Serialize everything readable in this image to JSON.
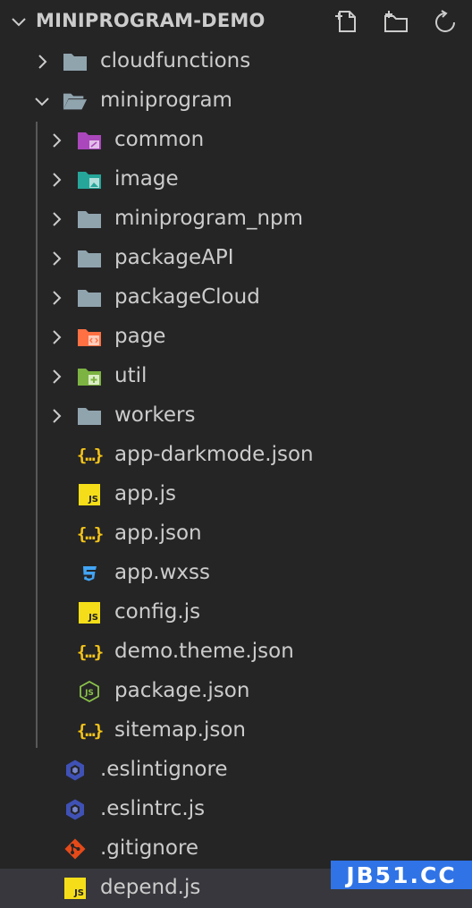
{
  "header": {
    "title": "MINIPROGRAM-DEMO",
    "actions": [
      "new-file-icon",
      "new-folder-icon",
      "refresh-icon"
    ]
  },
  "tree": [
    {
      "label": "cloudfunctions",
      "type": "folder",
      "expanded": false,
      "depth": 0,
      "icon": "folder-icon"
    },
    {
      "label": "miniprogram",
      "type": "folder",
      "expanded": true,
      "depth": 0,
      "icon": "folder-open-icon"
    },
    {
      "label": "common",
      "type": "folder",
      "expanded": false,
      "depth": 1,
      "icon": "folder-common-icon"
    },
    {
      "label": "image",
      "type": "folder",
      "expanded": false,
      "depth": 1,
      "icon": "folder-image-icon"
    },
    {
      "label": "miniprogram_npm",
      "type": "folder",
      "expanded": false,
      "depth": 1,
      "icon": "folder-icon"
    },
    {
      "label": "packageAPI",
      "type": "folder",
      "expanded": false,
      "depth": 1,
      "icon": "folder-icon"
    },
    {
      "label": "packageCloud",
      "type": "folder",
      "expanded": false,
      "depth": 1,
      "icon": "folder-icon"
    },
    {
      "label": "page",
      "type": "folder",
      "expanded": false,
      "depth": 1,
      "icon": "folder-page-icon"
    },
    {
      "label": "util",
      "type": "folder",
      "expanded": false,
      "depth": 1,
      "icon": "folder-util-icon"
    },
    {
      "label": "workers",
      "type": "folder",
      "expanded": false,
      "depth": 1,
      "icon": "folder-icon"
    },
    {
      "label": "app-darkmode.json",
      "type": "file",
      "depth": 1,
      "icon": "json-icon"
    },
    {
      "label": "app.js",
      "type": "file",
      "depth": 1,
      "icon": "js-icon"
    },
    {
      "label": "app.json",
      "type": "file",
      "depth": 1,
      "icon": "json-icon"
    },
    {
      "label": "app.wxss",
      "type": "file",
      "depth": 1,
      "icon": "css-icon"
    },
    {
      "label": "config.js",
      "type": "file",
      "depth": 1,
      "icon": "js-icon"
    },
    {
      "label": "demo.theme.json",
      "type": "file",
      "depth": 1,
      "icon": "json-icon"
    },
    {
      "label": "package.json",
      "type": "file",
      "depth": 1,
      "icon": "nodejs-icon"
    },
    {
      "label": "sitemap.json",
      "type": "file",
      "depth": 1,
      "icon": "json-icon"
    },
    {
      "label": ".eslintignore",
      "type": "file",
      "depth": 0,
      "icon": "eslint-icon"
    },
    {
      "label": ".eslintrc.js",
      "type": "file",
      "depth": 0,
      "icon": "eslint-icon"
    },
    {
      "label": ".gitignore",
      "type": "file",
      "depth": 0,
      "icon": "git-icon"
    },
    {
      "label": "depend.js",
      "type": "file",
      "depth": 0,
      "icon": "js-icon",
      "selected": true
    }
  ],
  "js_badge_text": "JS",
  "json_badge_text": "{…}",
  "watermark": "JB51.CC",
  "colors": {
    "background": "#252526",
    "text": "#cccccc",
    "selected_row": "#37373d",
    "folder": "#90a4ae",
    "js": "#f5de19",
    "json": "#f5c518",
    "css": "#42a5f5",
    "eslint": "#3f51b5",
    "git": "#e64a19",
    "nodejs": "#8bc34a",
    "watermark_bg": "#2f73e6"
  }
}
